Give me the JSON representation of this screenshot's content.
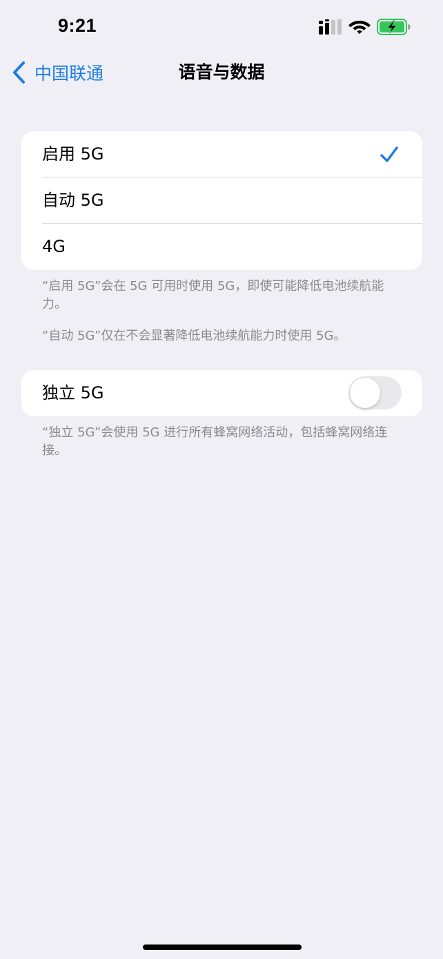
{
  "status_bar": {
    "time": "9:21",
    "icons": [
      "cellular-signal-icon",
      "wifi-icon",
      "battery-charging-icon"
    ]
  },
  "nav": {
    "back_label": "中国联通",
    "title": "语音与数据",
    "back_icon": "chevron-left-icon"
  },
  "network_options": [
    {
      "label": "启用 5G",
      "selected": true
    },
    {
      "label": "自动 5G",
      "selected": false
    },
    {
      "label": "4G",
      "selected": false
    }
  ],
  "footers": {
    "enable_5g": "“启用 5G”会在 5G 可用时使用 5G，即使可能降低电池续航能力。",
    "auto_5g": "“自动 5G”仅在不会显著降低电池续航能力时使用 5G。",
    "sa_5g": "“独立 5G”会使用 5G 进行所有蜂窝网络活动，包括蜂窝网络连接。"
  },
  "standalone_5g": {
    "label": "独立 5G",
    "enabled": false
  },
  "colors": {
    "background": "#f0eff5",
    "accent": "#1a7ee6",
    "footer_text": "#8a8a8e",
    "battery_fill": "#34c759"
  }
}
